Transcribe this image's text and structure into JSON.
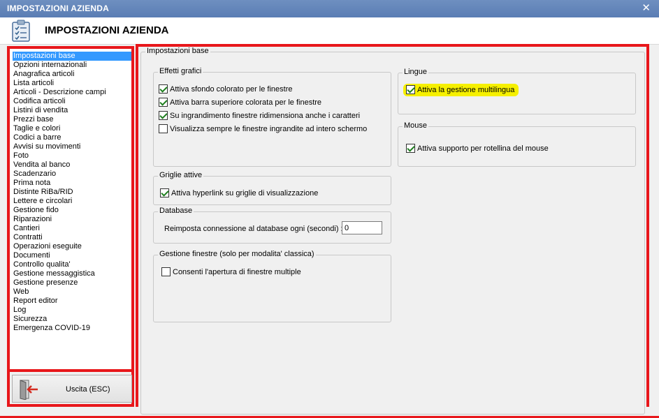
{
  "window": {
    "title": "IMPOSTAZIONI AZIENDA",
    "close_glyph": "✕"
  },
  "header": {
    "title": "IMPOSTAZIONI AZIENDA",
    "icon": "clipboard-checklist-icon"
  },
  "sidebar": {
    "selected_index": 0,
    "items": [
      {
        "label": "Impostazioni base"
      },
      {
        "label": "Opzioni internazionali"
      },
      {
        "label": "Anagrafica articoli"
      },
      {
        "label": "Lista articoli"
      },
      {
        "label": "Articoli - Descrizione campi"
      },
      {
        "label": "Codifica articoli"
      },
      {
        "label": "Listini di vendita"
      },
      {
        "label": "Prezzi base"
      },
      {
        "label": "Taglie e colori"
      },
      {
        "label": "Codici a barre"
      },
      {
        "label": "Avvisi su movimenti"
      },
      {
        "label": "Foto"
      },
      {
        "label": "Vendita al banco"
      },
      {
        "label": "Scadenzario"
      },
      {
        "label": "Prima nota"
      },
      {
        "label": "Distinte RiBa/RID"
      },
      {
        "label": "Lettere e circolari"
      },
      {
        "label": "Gestione fido"
      },
      {
        "label": "Riparazioni"
      },
      {
        "label": "Cantieri"
      },
      {
        "label": "Contratti"
      },
      {
        "label": "Operazioni eseguite"
      },
      {
        "label": "Documenti"
      },
      {
        "label": "Controllo qualita'"
      },
      {
        "label": "Gestione messaggistica"
      },
      {
        "label": "Gestione presenze"
      },
      {
        "label": "Web"
      },
      {
        "label": "Report editor"
      },
      {
        "label": "Log"
      },
      {
        "label": "Sicurezza"
      },
      {
        "label": "Emergenza COVID-19"
      }
    ],
    "exit_button": {
      "label": "Uscita (ESC)",
      "icon": "exit-door-icon"
    }
  },
  "main": {
    "section_title": "Impostazioni base",
    "effetti_grafici": {
      "title": "Effetti grafici",
      "options": [
        {
          "label": "Attiva sfondo colorato per le finestre",
          "checked": true
        },
        {
          "label": "Attiva barra superiore colorata per le finestre",
          "checked": true
        },
        {
          "label": "Su ingrandimento finestre ridimensiona anche i caratteri",
          "checked": true
        },
        {
          "label": "Visualizza sempre le finestre ingrandite ad intero schermo",
          "checked": false
        }
      ]
    },
    "griglie": {
      "title": "Griglie attive",
      "options": [
        {
          "label": "Attiva hyperlink su griglie di visualizzazione",
          "checked": true
        }
      ]
    },
    "database": {
      "title": "Database",
      "reconnect_label": "Reimposta connessione al database ogni (secondi) :",
      "reconnect_value": "0"
    },
    "gestione_finestre": {
      "title": "Gestione finestre (solo per modalita' classica)",
      "options": [
        {
          "label": "Consenti l'apertura di finestre multiple",
          "checked": false
        }
      ]
    },
    "lingue": {
      "title": "Lingue",
      "options": [
        {
          "label": "Attiva la gestione multilingua",
          "checked": true,
          "highlighted": true
        }
      ]
    },
    "mouse": {
      "title": "Mouse",
      "options": [
        {
          "label": "Attiva supporto per rotellina del mouse",
          "checked": true
        }
      ]
    }
  },
  "colors": {
    "title_bar": "#5a7db4",
    "red_border": "#e8171b",
    "selection": "#3399ff",
    "highlight": "#f6f000"
  }
}
